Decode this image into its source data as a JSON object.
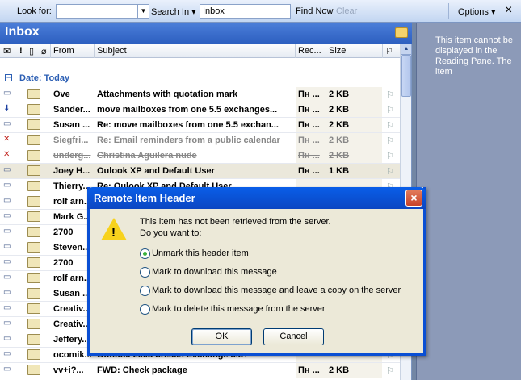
{
  "findbar": {
    "look_for_label": "Look for:",
    "look_for_value": "",
    "search_in_label": "Search In ▾",
    "search_in_value": "Inbox",
    "find_now": "Find Now",
    "clear": "Clear",
    "options": "Options ▾",
    "close": "×"
  },
  "folder": {
    "title": "Inbox"
  },
  "columns": {
    "from": "From",
    "subject": "Subject",
    "received": "Rec...",
    "size": "Size"
  },
  "group": {
    "label": "Date: Today",
    "toggle": "−"
  },
  "messages": [
    {
      "from": "Ove",
      "subject": "Attachments with quotation mark",
      "received": "Пн ...",
      "size": "2 KB",
      "icon": "mail-icon",
      "state": "unread"
    },
    {
      "from": "Sander...",
      "subject": "move mailboxes from one 5.5 exchanges...",
      "received": "Пн ...",
      "size": "2 KB",
      "icon": "mail-download-icon",
      "state": "unread"
    },
    {
      "from": "Susan ...",
      "subject": "Re: move mailboxes from one 5.5 exchan...",
      "received": "Пн ...",
      "size": "2 KB",
      "icon": "mail-icon",
      "state": "unread"
    },
    {
      "from": "Siegfri...",
      "subject": "Re: Email reminders from a public calendar",
      "received": "Пн ...",
      "size": "2 KB",
      "icon": "mail-delete-icon",
      "state": "deleted"
    },
    {
      "from": "underg...",
      "subject": "Christina Aguilera nude",
      "received": "Пн ...",
      "size": "2 KB",
      "icon": "mail-delete-icon",
      "state": "deleted"
    },
    {
      "from": "Joey H...",
      "subject": "Oulook XP and Default User",
      "received": "Пн ...",
      "size": "1 KB",
      "icon": "mail-icon",
      "state": "selected"
    },
    {
      "from": "Thierry...",
      "subject": "Re: Oulook XP and Default User",
      "received": "",
      "size": "",
      "icon": "mail-icon",
      "state": "unread"
    },
    {
      "from": "rolf arn...",
      "subject": "",
      "received": "",
      "size": "",
      "icon": "mail-icon",
      "state": "unread"
    },
    {
      "from": "Mark G...",
      "subject": "",
      "received": "",
      "size": "",
      "icon": "mail-icon",
      "state": "unread"
    },
    {
      "from": "2700",
      "subject": "",
      "received": "",
      "size": "",
      "icon": "mail-icon",
      "state": "unread"
    },
    {
      "from": "Steven...",
      "subject": "",
      "received": "",
      "size": "",
      "icon": "mail-icon",
      "state": "unread"
    },
    {
      "from": "2700",
      "subject": "",
      "received": "",
      "size": "",
      "icon": "mail-icon",
      "state": "unread"
    },
    {
      "from": "rolf arn...",
      "subject": "",
      "received": "",
      "size": "",
      "icon": "mail-icon",
      "state": "unread"
    },
    {
      "from": "Susan ...",
      "subject": "",
      "received": "",
      "size": "",
      "icon": "mail-icon",
      "state": "unread"
    },
    {
      "from": "Creativ...",
      "subject": "",
      "received": "",
      "size": "",
      "icon": "mail-icon",
      "state": "unread"
    },
    {
      "from": "Creativ...",
      "subject": "",
      "received": "",
      "size": "",
      "icon": "mail-icon",
      "state": "unread"
    },
    {
      "from": "Jeffery...",
      "subject": "",
      "received": "",
      "size": "",
      "icon": "mail-icon",
      "state": "unread"
    },
    {
      "from": "ocomik...",
      "subject": "Outlook 2003 breaks Exchange 5.5?",
      "received": "",
      "size": "",
      "icon": "mail-icon",
      "state": "unread"
    },
    {
      "from": "vv+i?...",
      "subject": "FWD: Check package",
      "received": "Пн ...",
      "size": "2 KB",
      "icon": "mail-icon",
      "state": "unread"
    }
  ],
  "reading_pane": {
    "message": "This item cannot be displayed in the Reading Pane. The item"
  },
  "dialog": {
    "title": "Remote Item Header",
    "close": "×",
    "line1": "This item has not been retrieved from the server.",
    "line2": "Do you want to:",
    "options": [
      {
        "label": "Unmark this header item",
        "selected": true
      },
      {
        "label": "Mark to download this message",
        "selected": false
      },
      {
        "label": "Mark to download this message and leave a copy on the server",
        "selected": false
      },
      {
        "label": "Mark to delete this message from the server",
        "selected": false
      }
    ],
    "ok": "OK",
    "cancel": "Cancel"
  }
}
